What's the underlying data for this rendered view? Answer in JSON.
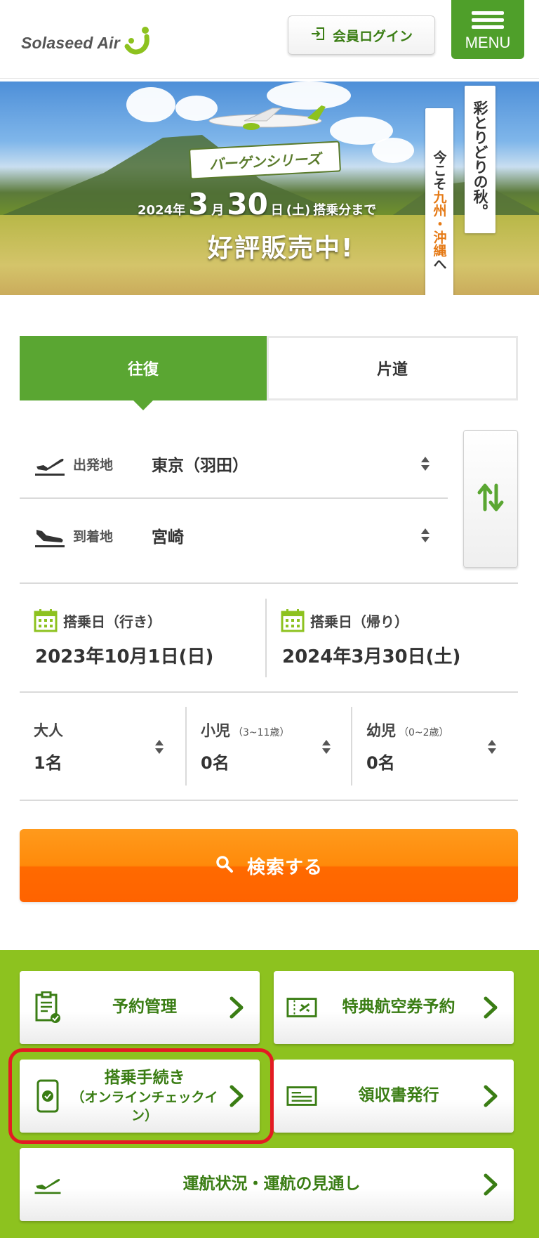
{
  "header": {
    "logo_text": "Solaseed Air",
    "login_label": "会員ログイン",
    "menu_label": "MENU"
  },
  "banner": {
    "series": "バーゲンシリーズ",
    "date_year": "2024年",
    "date_month_num": "3",
    "date_month_unit": "月",
    "date_day_num": "30",
    "date_day_unit": "日",
    "date_weekday": "(土)",
    "date_suffix": "搭乗分まで",
    "sale_text": "好評販売中!",
    "tagline_vertical1_a": "今こそ",
    "tagline_vertical1_b": "九州・沖縄",
    "tagline_vertical1_c": "へ",
    "tagline_vertical2": "彩とりどりの秋。"
  },
  "trip_tabs": {
    "round_trip": "往復",
    "one_way": "片道"
  },
  "route": {
    "departure_label": "出発地",
    "departure_value": "東京（羽田）",
    "arrival_label": "到着地",
    "arrival_value": "宮崎"
  },
  "dates": {
    "outbound_label": "搭乗日（行き）",
    "outbound_value": "2023年10月1日(日)",
    "return_label": "搭乗日（帰り）",
    "return_value": "2024年3月30日(土)"
  },
  "passengers": {
    "adult_label": "大人",
    "adult_value": "1名",
    "child_label": "小児",
    "child_age": "（3~11歳）",
    "child_value": "0名",
    "infant_label": "幼児",
    "infant_age": "（0~2歳）",
    "infant_value": "0名"
  },
  "search_label": "検索する",
  "quick_links": {
    "reservation": "予約管理",
    "award_ticket": "特典航空券予約",
    "checkin_main": "搭乗手続き",
    "checkin_sub": "（オンラインチェックイン）",
    "receipt": "領収書発行",
    "flight_status": "運航状況・運航の見通し"
  },
  "colors": {
    "brand_green": "#5aa632",
    "light_green": "#8dc21f",
    "orange": "#ff7a00",
    "highlight_red": "#e31b23"
  },
  "icons": {
    "login": "login-icon",
    "menu": "hamburger-icon",
    "departure": "takeoff-icon",
    "arrival": "landing-icon",
    "swap": "swap-vertical-icon",
    "calendar": "calendar-icon",
    "search": "search-icon",
    "reservation": "clipboard-icon",
    "award": "ticket-icon",
    "checkin": "smartphone-check-icon",
    "receipt": "receipt-icon",
    "flight_status": "takeoff-icon",
    "arrow": "chevron-right-icon"
  }
}
